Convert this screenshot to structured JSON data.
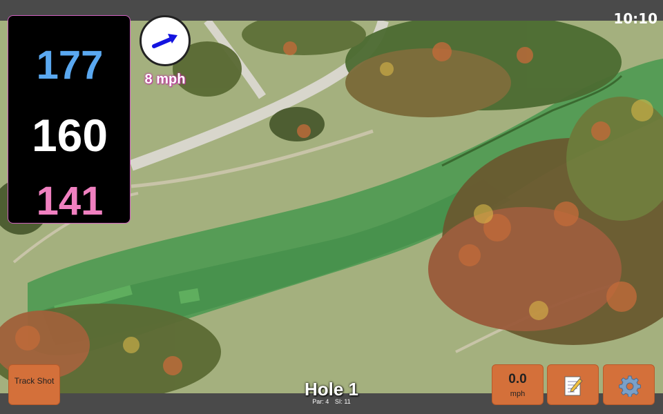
{
  "status": {
    "clock": "10:10"
  },
  "distances": {
    "back": "177",
    "middle": "160",
    "front": "141"
  },
  "wind": {
    "speed": "8 mph",
    "arrow_icon": "wind-arrow-icon",
    "arrow_color": "#1414e0"
  },
  "hole": {
    "title": "Hole 1",
    "par": "Par: 4",
    "si": "SI: 11"
  },
  "buttons": {
    "track_shot": "Track Shot",
    "speed_value": "0.0",
    "speed_unit": "mph",
    "notes_icon": "notepad-icon",
    "settings_icon": "gear-icon"
  },
  "colors": {
    "back_distance": "#5aa8f0",
    "middle_distance": "#ffffff",
    "front_distance": "#f080c0",
    "button": "#d4703a"
  }
}
